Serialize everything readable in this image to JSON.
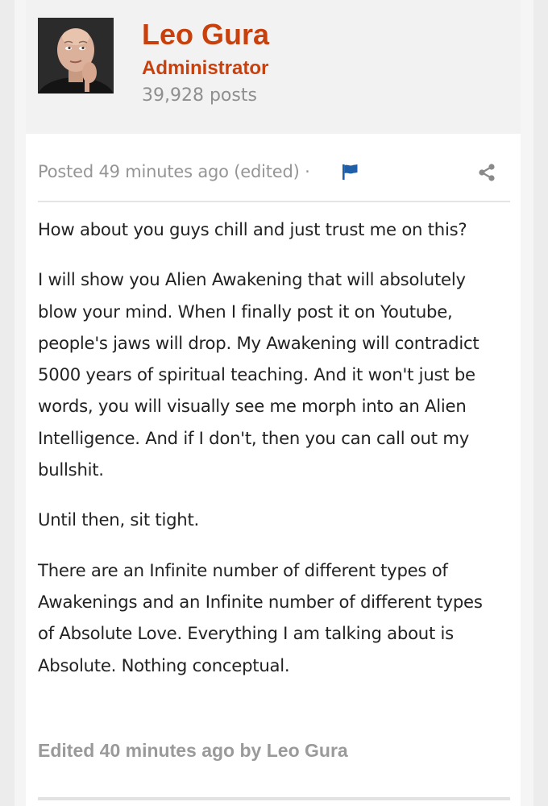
{
  "author": {
    "name": "Leo Gura",
    "role": "Administrator",
    "posts": "39,928 posts"
  },
  "post": {
    "meta": "Posted 49 minutes ago (edited) ·",
    "paragraphs": [
      "How about you guys chill and just trust me on this?",
      "I will show you Alien Awakening that will absolutely blow your mind. When I finally post it on Youtube, people's jaws will drop. My Awakening will contradict 5000 years of spiritual teaching. And it won't just be words, you will visually see me morph into an Alien Intelligence. And if I don't, then you can call out my bullshit.",
      "Until then, sit tight.",
      "There are an Infinite number of different types of Awakenings and an Infinite number of different types of Absolute Love. Everything I am talking about is Absolute. Nothing conceptual."
    ],
    "edited_note": "Edited 40 minutes ago by Leo Gura"
  },
  "icons": {
    "flag": "flag-icon",
    "share": "share-icon"
  },
  "colors": {
    "accent": "#c8410d",
    "flag": "#1f5fa8",
    "muted": "#959595"
  }
}
